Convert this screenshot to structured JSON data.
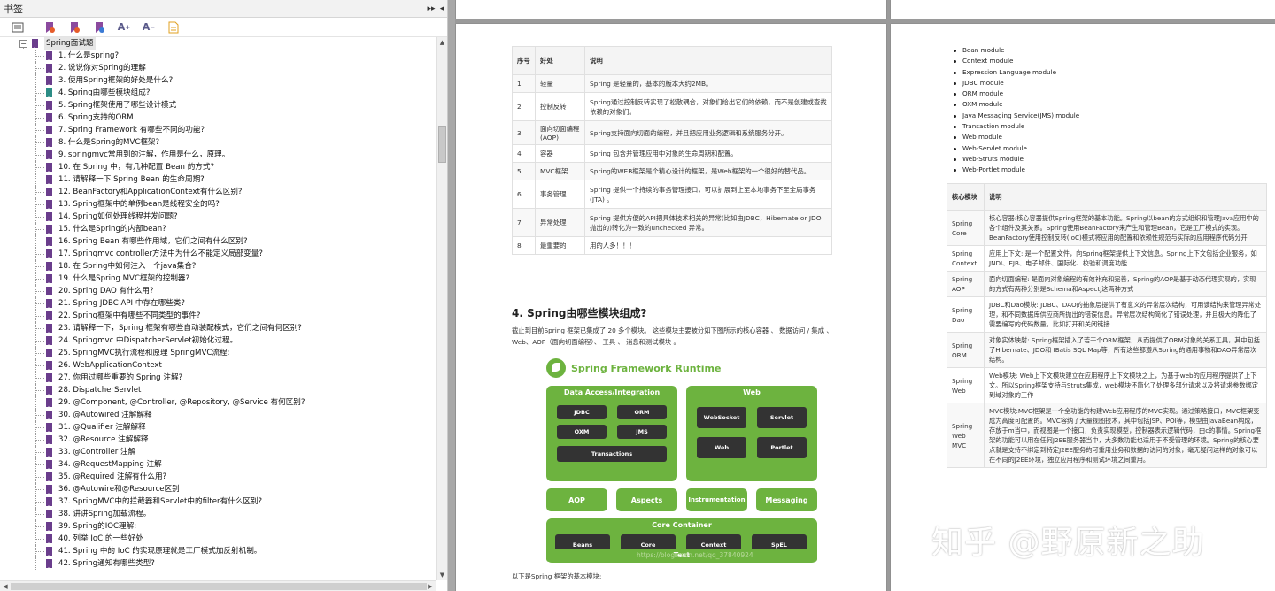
{
  "sidebar": {
    "title": "书签",
    "toolbar_icons": [
      "list-icon",
      "bookmark-add-icon",
      "bookmark-remove-icon",
      "bookmark-expand-icon",
      "font-larger-icon",
      "font-smaller-icon",
      "page-icon"
    ],
    "font_up": "A",
    "font_down": "A",
    "root": "Spring面试题",
    "items": [
      "1. 什么是spring?",
      "2. 说说你对Spring的理解",
      "3. 使用Spring框架的好处是什么?",
      "4. Spring由哪些模块组成?",
      "5. Spring框架使用了哪些设计模式",
      "6. Spring支持的ORM",
      "7. Spring Framework 有哪些不同的功能?",
      "8. 什么是Spring的MVC框架?",
      "9. springmvc常用到的注解，作用是什么，原理。",
      "10. 在 Spring 中，有几种配置 Bean 的方式?",
      "11. 请解释一下 Spring Bean 的生命周期?",
      "12. BeanFactory和ApplicationContext有什么区别?",
      "13. Spring框架中的单例bean是线程安全的吗?",
      "14. Spring如何处理线程并发问题?",
      "15. 什么是Spring的内部bean?",
      "16. Spring Bean 有哪些作用域，它们之间有什么区别?",
      "17. Springmvc controller方法中为什么不能定义局部变量?",
      "18. 在 Spring中如何注入一个java集合?",
      "19. 什么是Spring MVC框架的控制器?",
      "20. Spring DAO 有什么用?",
      "21. Spring JDBC API 中存在哪些类?",
      "22. Spring框架中有哪些不同类型的事件?",
      "23. 请解释一下，Spring 框架有哪些自动装配模式，它们之间有何区别?",
      "24. Springmvc 中DispatcherServlet初始化过程。",
      "25. SpringMVC执行流程和原理 SpringMVC流程:",
      "26. WebApplicationContext",
      "27. 你用过哪些重要的 Spring 注解?",
      "28. DispatcherServlet",
      "29. @Component, @Controller, @Repository, @Service 有何区别?",
      "30. @Autowired 注解解释",
      "31. @Qualifier 注解解释",
      "32. @Resource 注解解释",
      "33. @Controller 注解",
      "34. @RequestMapping 注解",
      "35. @Required 注解有什么用?",
      "36. @Autowire和@Resource区别",
      "37. SpringMVC中的拦截器和Servlet中的filter有什么区别?",
      "38. 讲讲Spring加载流程。",
      "39. Spring的IOC理解:",
      "40. 列举 IoC 的一些好处",
      "41. Spring 中的 IoC 的实现原理就是工厂模式加反射机制。",
      "42. Spring通知有哪些类型?"
    ],
    "highlighted_index": 3
  },
  "page1": {
    "table": {
      "headers": [
        "序号",
        "好处",
        "说明"
      ],
      "rows": [
        [
          "1",
          "轻量",
          "Spring 是轻量的，基本的版本大约2MB。"
        ],
        [
          "2",
          "控制反转",
          "Spring通过控制反转实现了松散耦合，对象们给出它们的依赖，而不是创建或查找依赖的对象们。"
        ],
        [
          "3",
          "面向切面编程(AOP)",
          "Spring支持面向切面的编程，并且把应用业务逻辑和系统服务分开。"
        ],
        [
          "4",
          "容器",
          "Spring 包含并管理应用中对象的生命周期和配置。"
        ],
        [
          "5",
          "MVC框架",
          "Spring的WEB框架是个精心设计的框架，是Web框架的一个很好的替代品。"
        ],
        [
          "6",
          "事务管理",
          "Spring 提供一个持续的事务管理接口，可以扩展到上至本地事务下至全局事务 (JTA) 。"
        ],
        [
          "7",
          "异常处理",
          "Spring 提供方便的API把具体技术相关的异常(比如由JDBC，Hibernate or JDO抛出的)转化为一致的unchecked 异常。"
        ],
        [
          "8",
          "最重要的",
          "用的人多！！！"
        ]
      ]
    },
    "heading": "4. Spring由哪些模块组成?",
    "intro": "截止到目前Spring 框架已集成了 20 多个模块。 这些模块主要被分如下图所示的核心容器 、 数据访问 / 集成 、Web、AOP（面向切面编程）、 工具 、 消息和测试模块 。",
    "outro": "以下是Spring 框架的基本模块:",
    "diagram": {
      "title": "Spring Framework Runtime",
      "data_access": "Data Access/Integration",
      "jdbc": "JDBC",
      "orm": "ORM",
      "oxm": "OXM",
      "jms": "JMS",
      "transactions": "Transactions",
      "web": "Web",
      "websocket": "WebSocket",
      "servlet": "Servlet",
      "web_inner": "Web",
      "portlet": "Portlet",
      "aop": "AOP",
      "aspects": "Aspects",
      "instrumentation": "Instrumentation",
      "messaging": "Messaging",
      "core_container": "Core Container",
      "beans": "Beans",
      "core": "Core",
      "context": "Context",
      "spel": "SpEL",
      "test": "Test",
      "watermark": "https://blog.csdn.net/qq_37840924"
    }
  },
  "page2": {
    "modules": [
      "Bean module",
      "Context module",
      "Expression Language module",
      "JDBC module",
      "ORM module",
      "OXM module",
      "Java Messaging Service(JMS) module",
      "Transaction module",
      "Web module",
      "Web-Servlet module",
      "Web-Struts module",
      "Web-Portlet module"
    ],
    "table": {
      "headers": [
        "核心模块",
        "说明"
      ],
      "rows": [
        [
          "Spring Core",
          "核心容器:核心容器提供Spring框架的基本功能。Spring以bean的方式组织和管理Java应用中的各个组件及其关系。Spring使用BeanFactory来产生和管理Bean，它是工厂模式的实现。BeanFactory使用控制反转(IoC)模式将应用的配置和依赖性规范与实际的应用程序代码分开"
        ],
        [
          "Spring Context",
          "应用上下文: 是一个配置文件，向Spring框架提供上下文信息。Spring上下文包括企业服务，如JNDI、EJB、电子邮件、国际化、校验和调度功能"
        ],
        [
          "Spring AOP",
          "面向切面编程: 是面向对象编程的有效补充和完善，Spring的AOP是基于动态代理实现的，实现的方式有两种分别是Schema和AspectJ这两种方式"
        ],
        [
          "Spring Dao",
          "JDBC和Dao模块: JDBC、DAO的抽象层提供了有意义的异常层次结构，可用该结构来管理异常处理，和不同数据库供应商所抛出的错误信息。异常层次结构简化了错误处理，并且极大的降低了需要编写的代码数量，比如打开和关闭链接"
        ],
        [
          "Spring ORM",
          "对象实体映射: Spring框架插入了若干个ORM框架，从而提供了ORM对象的关系工具，其中包括了Hibernate、JDO和 IBatis SQL Map等，所有这些都遵从Spring的通用事物和DAO异常层次结构。"
        ],
        [
          "Spring Web",
          "Web模块: Web上下文模块建立在应用程序上下文模块之上，为基于web的应用程序提供了上下文。所以Spring框架支持与Struts集成，web模块还简化了处理多部分请求以及将请求参数绑定到域对象的工作"
        ],
        [
          "Spring Web MVC",
          "MVC模块:MVC框架是一个全功能的构建Web应用程序的MVC实现。通过策略接口，MVC框架变成为高度可配置的。MVC容纳了大量视图技术，其中包括JSP、POI等，模型由JavaBean构成，存放于m当中，而视图是一个接口，负责实现模型，控制器表示逻辑代码，由c的事情。Spring框架的功能可以用在任何J2EE服务器当中，大多数功能也适用于不受管理的环境。Spring的核心要点就是支持不绑定到特定J2EE服务的可重用业务和数据的访问的对象，毫无疑问这样的对象可以在不同的J2EE环境，独立应用程序和测试环境之间重用。"
        ]
      ]
    }
  },
  "watermark": "知乎 @野原新之助"
}
